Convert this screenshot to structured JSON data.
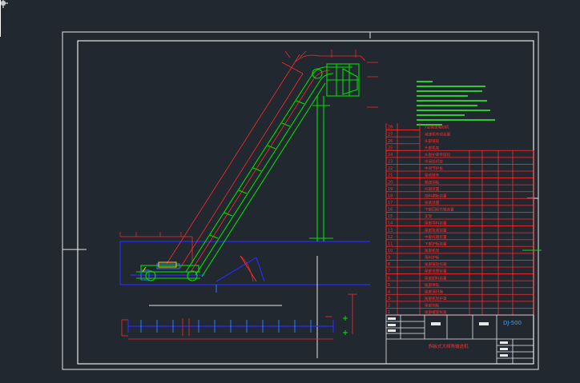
{
  "colors": {
    "background": "#212830",
    "frame": "#ffffff",
    "table": "#ff2a2a",
    "outline": "#00e000",
    "dimension": "#ff2a2a",
    "ground": "#2222ff",
    "notes": "#33ff33",
    "text_red": "#ff3030",
    "text_blue": "#3aa0ff"
  },
  "title_block": {
    "drawing_code": "DJ-500",
    "drawing_title": "斜板式大倾角输送机"
  },
  "bom_rows": [
    "Y型输送电动机",
    "减速机传动装置",
    "头部链轮",
    "头部机架",
    "头部护罩带链轮",
    "中间段机架",
    "中间节护板",
    "驱动链条",
    "输送斜板",
    "托辊装置",
    "挡料裙板装置",
    "张紧装置",
    "下部回程托辊装置",
    "支架",
    "尾部导料装置",
    "尾部张紧装置",
    "中部托辊装置",
    "下部护板装置",
    "尾部机架",
    "落料护板",
    "尾部链轮托辊",
    "尾部支撑装置",
    "尾部卸料装置",
    "尾部导轨",
    "尾部清扫器",
    "尾部机架护罩",
    "尾部挡板",
    "尾部螺旋张紧"
  ]
}
